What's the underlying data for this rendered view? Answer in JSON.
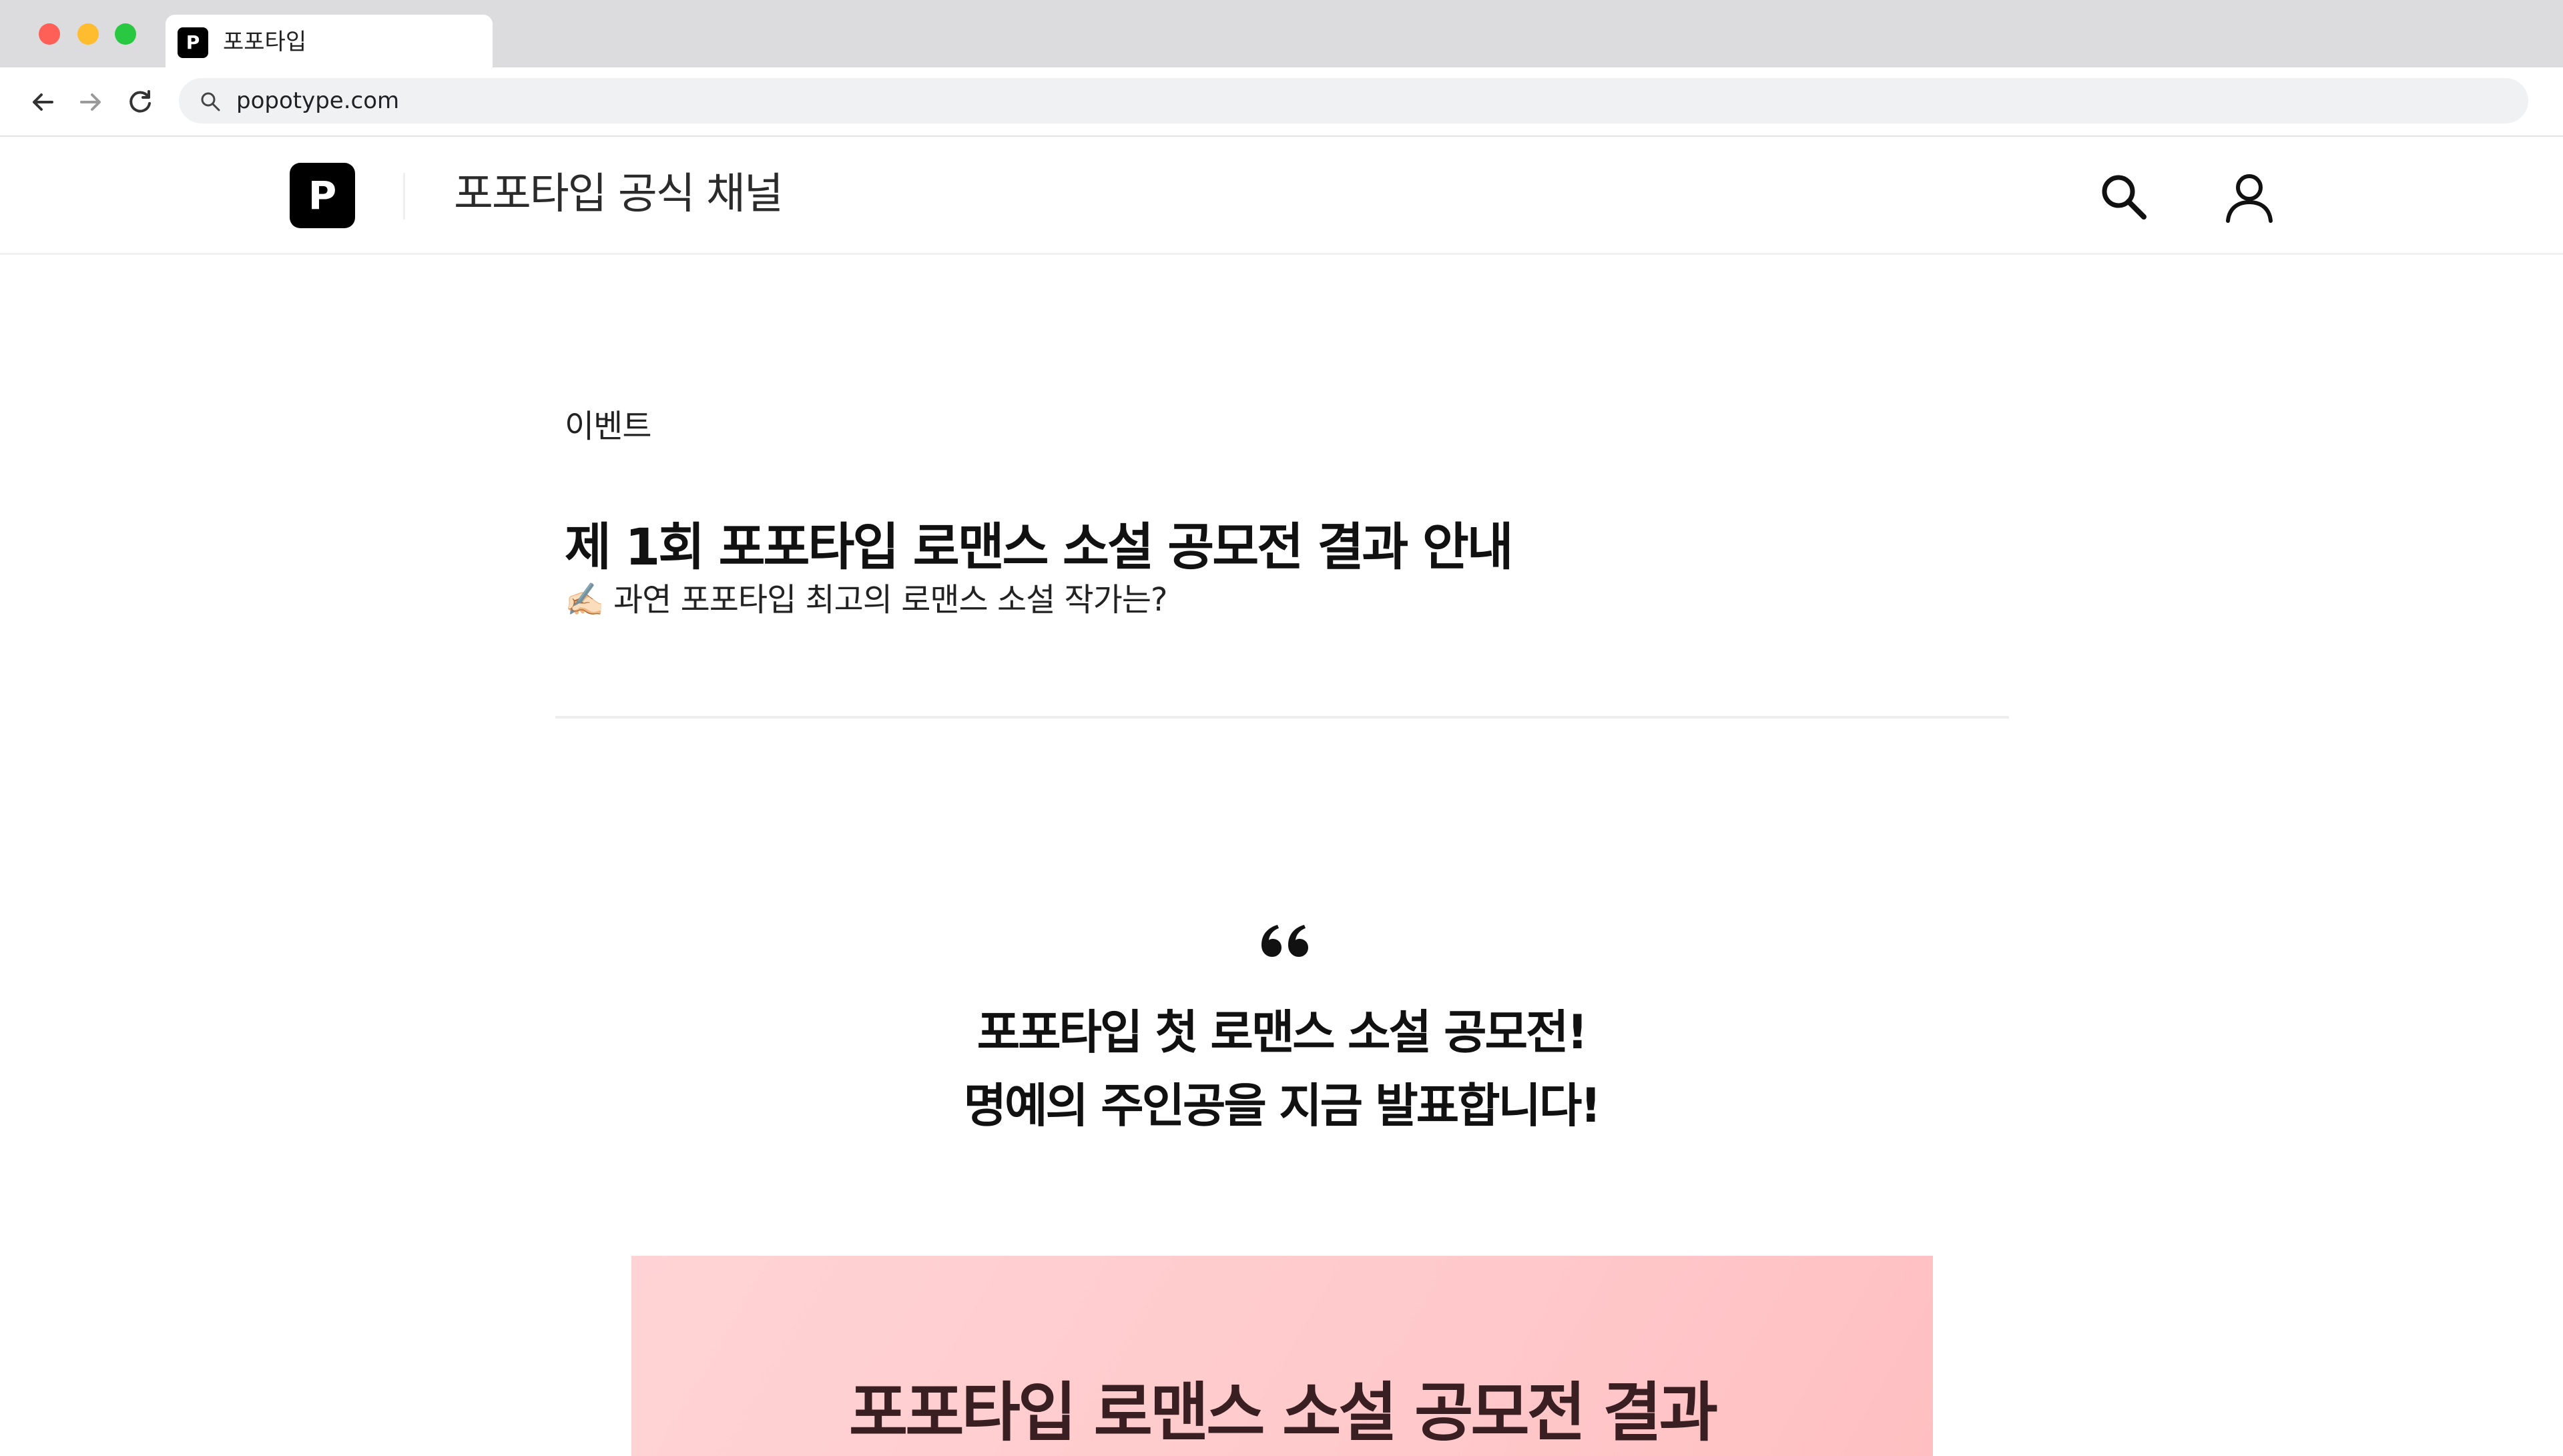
{
  "browser": {
    "tab": {
      "title": "포포타입",
      "favicon_letter": "P"
    },
    "address": {
      "url": "popotype.com"
    }
  },
  "site": {
    "logo_letter": "P",
    "channel_title": "포포타입 공식 채널"
  },
  "article": {
    "category": "이벤트",
    "title": "제 1회 포포타입 로맨스 소설 공모전 결과 안내",
    "subtitle": "✍🏻 과연 포포타입 최고의 로맨스 소설 작가는?",
    "quote_lines": [
      "포포타입 첫 로맨스 소설 공모전!",
      "명예의 주인공을 지금 발표합니다!"
    ],
    "banner_title": "포포타입 로맨스 소설 공모전 결과"
  },
  "icons": {
    "window_controls": [
      "close-dot",
      "minimize-dot",
      "maximize-dot"
    ],
    "nav": [
      "back-arrow-icon",
      "forward-arrow-icon",
      "reload-icon"
    ],
    "header": [
      "search-icon",
      "user-icon"
    ],
    "content": [
      "quote-icon"
    ]
  },
  "colors": {
    "close": "#fe5f57",
    "minimize": "#febc2e",
    "maximize": "#28c840",
    "banner_start": "#ffd3d5",
    "banner_end": "#ffbfc2",
    "logo_bg": "#000000"
  }
}
